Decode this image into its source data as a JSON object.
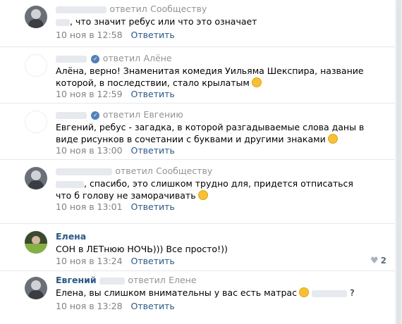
{
  "comments": [
    {
      "author": "",
      "replied": "ответил",
      "target": "Сообществу",
      "text": ", что значит ребус или что это означает",
      "date": "10 ноя в 12:58",
      "reply": "Ответить"
    },
    {
      "author": "",
      "replied": "ответил",
      "target": "Алёне",
      "text": "Алёна, верно! Знаменитая комедия Уильяма Шекспира, название которой, в последствии, стало крылатым",
      "date": "10 ноя в 12:59",
      "reply": "Ответить"
    },
    {
      "author": "",
      "replied": "ответил",
      "target": "Евгению",
      "text": "Евгений, ребус - загадка, в которой разгадываемые слова даны в виде рисунков в сочетании с буквами и другими знаками",
      "date": "10 ноя в 13:00",
      "reply": "Ответить"
    },
    {
      "author": "",
      "replied": "ответил",
      "target": "Сообществу",
      "text": ", спасибо, это слишком трудно для, придется отписаться что б голову не заморачивать",
      "date": "10 ноя в 13:01",
      "reply": "Ответить"
    },
    {
      "author": "Елена",
      "text": "СОН в ЛЕТнюю НОЧЬ))) Все просто!))",
      "date": "10 ноя в 13:24",
      "reply": "Ответить",
      "likes": "2"
    },
    {
      "author": "Евгений",
      "replied": "ответил",
      "target": "Елене",
      "text": "Елена, вы слишком внимательны у вас есть матрас",
      "text_end": "?",
      "date": "10 ноя в 13:28",
      "reply": "Ответить"
    }
  ],
  "icons": {
    "verified": "verified-check-icon",
    "like": "heart-icon",
    "emoji": "smile-emoji-icon"
  }
}
